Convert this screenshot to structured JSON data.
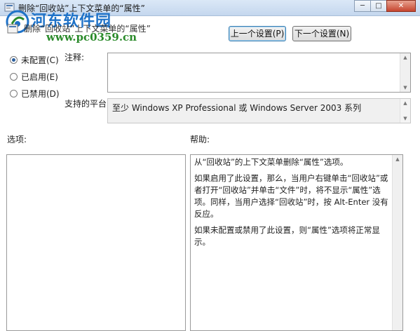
{
  "window": {
    "title": "删除“回收站”上下文菜单的“属性”",
    "controls": {
      "minimize": "─",
      "maximize": "□",
      "close": "✕"
    }
  },
  "watermark": {
    "name": "河东软件园",
    "url": "www.pc0359.cn"
  },
  "header": {
    "setting_name": "删除“回收站”上下文菜单的“属性”",
    "prev_label": "上一个设置(P)",
    "next_label": "下一个设置(N)"
  },
  "state": {
    "options": [
      {
        "label": "未配置(C)",
        "checked": true
      },
      {
        "label": "已启用(E)",
        "checked": false
      },
      {
        "label": "已禁用(D)",
        "checked": false
      }
    ]
  },
  "comment": {
    "label": "注释:",
    "value": ""
  },
  "platform": {
    "label": "支持的平台:",
    "value": "至少 Windows XP Professional 或 Windows Server 2003 系列"
  },
  "options_section": {
    "label": "选项:"
  },
  "help_section": {
    "label": "帮助:",
    "paragraphs": [
      "从“回收站”的上下文菜单删除“属性”选项。",
      "如果启用了此设置，那么，当用户右键单击“回收站”或者打开“回收站”并单击“文件”时，将不显示“属性”选项。同样，当用户选择“回收站”时，按 Alt-Enter 没有反应。",
      "如果未配置或禁用了此设置，则“属性”选项将正常显示。"
    ]
  },
  "icons": {
    "app": "policy-icon",
    "watermark_logo": "watermark-logo-icon"
  },
  "colors": {
    "accent": "#2c5f9e",
    "watermark_blue": "#1e72c8",
    "watermark_green": "#2a8a2a"
  }
}
